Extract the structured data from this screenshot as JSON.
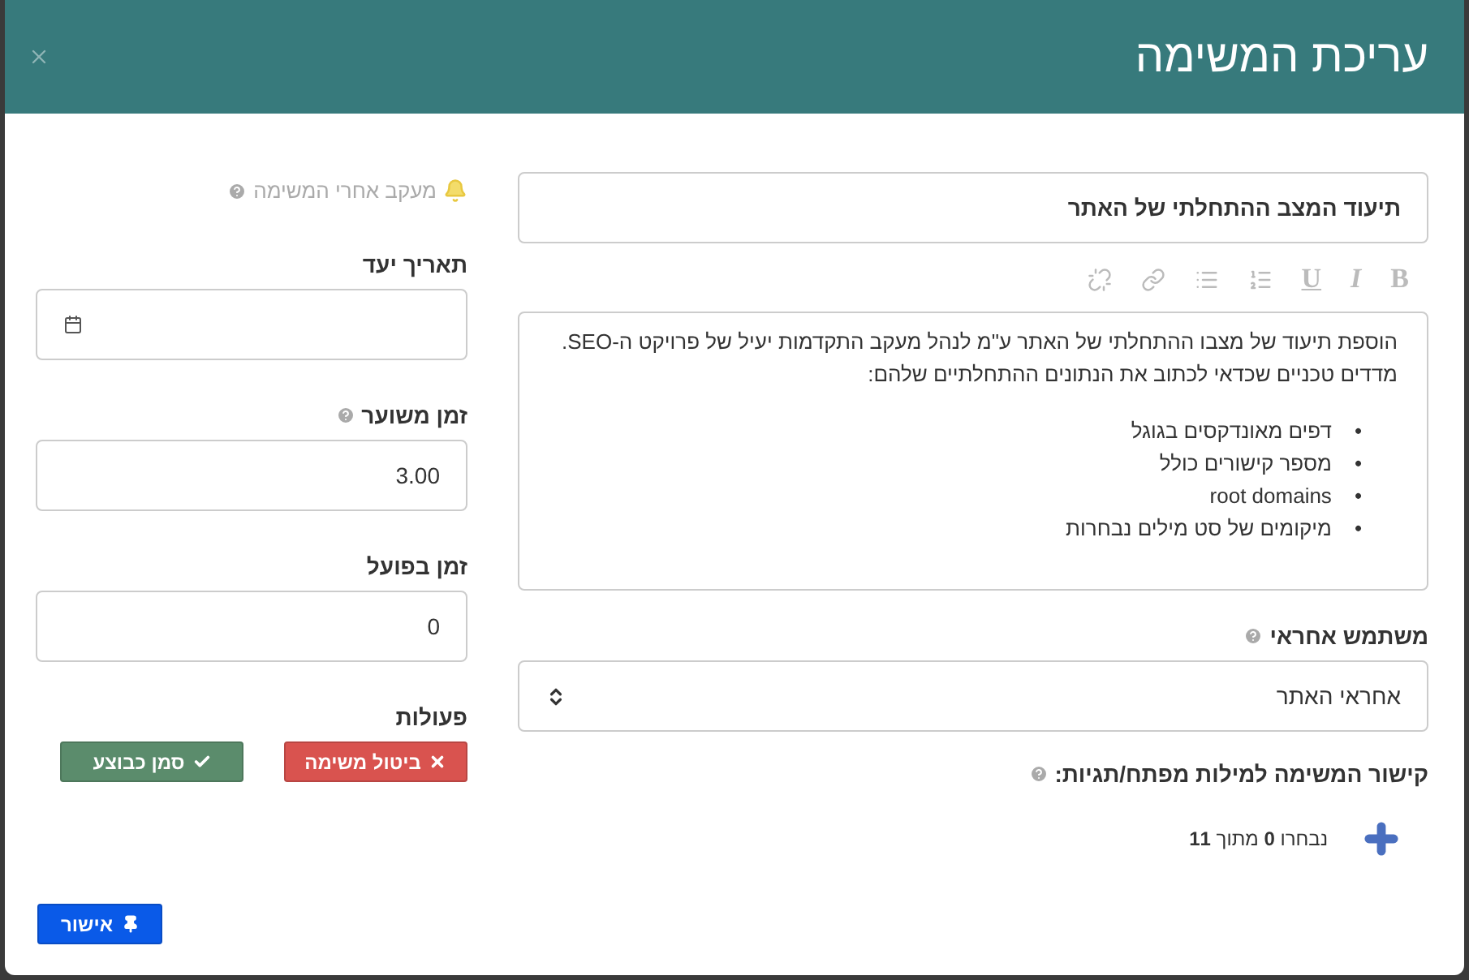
{
  "dialog": {
    "title": "עריכת המשימה"
  },
  "task_title": {
    "value": "תיעוד המצב ההתחלתי של האתר"
  },
  "format_buttons": [
    "B",
    "I",
    "U"
  ],
  "description": {
    "lines": [
      "הוספת תיעוד של מצבו ההתחלתי של האתר ע\"מ לנהל מעקב התקדמות יעיל של פרויקט ה-SEO.",
      "מדדים טכניים שכדאי לכתוב את הנתונים ההתחלתיים שלהם:"
    ],
    "bullets": [
      {
        "marker": "•",
        "text": "דפים מאונדקסים בגוגל"
      },
      {
        "marker": "•",
        "text": "מספר קישורים כולל"
      },
      {
        "marker": "•",
        "text": "root domains"
      },
      {
        "marker": "•",
        "text": "מיקומים של סט מילים נבחרות"
      }
    ]
  },
  "responsible": {
    "label": "משתמש אחראי",
    "value": "אחראי האתר"
  },
  "keywords": {
    "label": "קישור המשימה למילות מפתח/תגיות:",
    "counter": "נבחרו **0** מתוך **11**"
  },
  "watch": {
    "label": "מעקב אחרי המשימה",
    "on": false
  },
  "due_date": {
    "label": "תאריך יעד"
  },
  "estimated_time": {
    "label": "זמן משוער",
    "value": "3.00"
  },
  "actual_time": {
    "label": "זמן בפועל",
    "value": "0"
  },
  "actions": {
    "label": "פעולות",
    "buttons": [
      {
        "kind": "danger",
        "label": "ביטול משימה"
      },
      {
        "kind": "success",
        "label": "סמן כבוצע"
      }
    ]
  },
  "confirm": {
    "label": "אישור"
  }
}
